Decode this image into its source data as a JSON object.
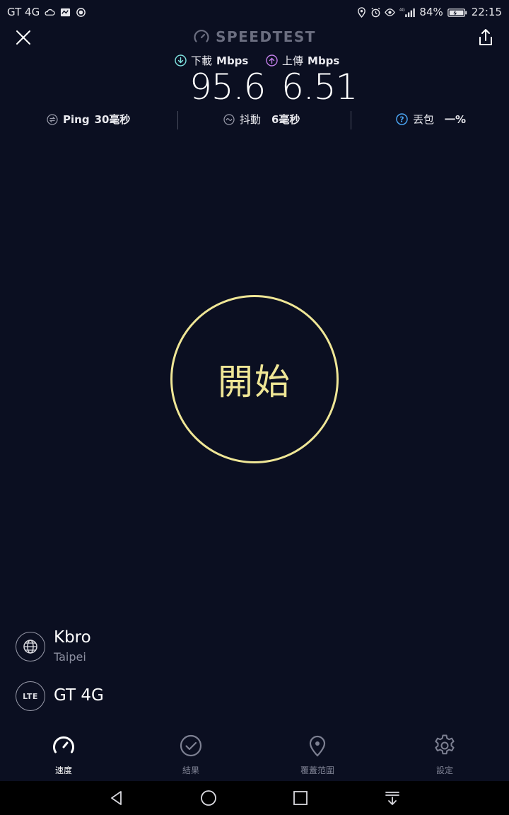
{
  "status_bar": {
    "carrier": "GT 4G",
    "battery": "84%",
    "time": "22:15"
  },
  "header": {
    "brand": "SPEEDTEST"
  },
  "download": {
    "label": "下載",
    "unit": "Mbps",
    "value": "95.6"
  },
  "upload": {
    "label": "上傳",
    "unit": "Mbps",
    "value": "6.51"
  },
  "stats": {
    "ping_label": "Ping",
    "ping_value": "30毫秒",
    "jitter_label": "抖動",
    "jitter_value": "6毫秒",
    "loss_label": "丟包",
    "loss_value": "一%"
  },
  "start_button": {
    "label": "開始"
  },
  "provider": {
    "name": "Kbro",
    "location": "Taipei"
  },
  "network": {
    "badge": "LTE",
    "name": "GT 4G"
  },
  "bottom_nav": {
    "speed": "速度",
    "results": "結果",
    "coverage": "覆蓋范圍",
    "settings": "設定"
  },
  "colors": {
    "background": "#0b0f21",
    "accent_yellow": "#efe696",
    "download_cyan": "#7fe3e0",
    "upload_purple": "#c27ee8"
  }
}
